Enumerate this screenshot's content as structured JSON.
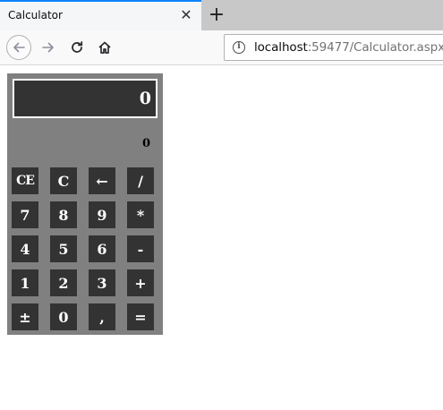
{
  "browser": {
    "tab_title": "Calculator",
    "tab_close_icon": "close-icon",
    "new_tab_icon": "plus-icon",
    "url_host": "localhost",
    "url_rest": ":59477/Calculator.aspx",
    "nav_icons": [
      "back-arrow-icon",
      "forward-arrow-icon",
      "reload-icon",
      "home-icon"
    ]
  },
  "calculator": {
    "display_value": "0",
    "secondary_value": "0",
    "colors": {
      "panel": "#808080",
      "key": "#333333",
      "key_text": "#ffffff",
      "display_border": "#ffffff"
    },
    "keys": [
      [
        "CE",
        "C",
        "←",
        "/"
      ],
      [
        "7",
        "8",
        "9",
        "*"
      ],
      [
        "4",
        "5",
        "6",
        "-"
      ],
      [
        "1",
        "2",
        "3",
        "+"
      ],
      [
        "±",
        "0",
        ",",
        "="
      ]
    ]
  }
}
